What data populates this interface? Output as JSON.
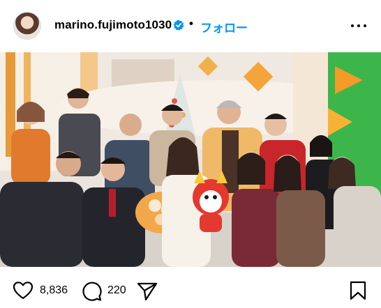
{
  "header": {
    "username": "marino.fujimoto1030",
    "separator": "•",
    "follow_label": "フォロー"
  },
  "photo": {
    "alt": "group photo on a TV studio set with bouquet and mascot"
  },
  "actions": {
    "like_count": "8,836",
    "comment_count": "220"
  },
  "colors": {
    "follow_blue": "#0095f6",
    "verified_blue": "#0095f6",
    "icon_black": "#000000"
  },
  "icons": [
    "avatar",
    "verified-badge-icon",
    "more-options-icon",
    "heart-icon",
    "comment-icon",
    "share-icon",
    "bookmark-icon"
  ]
}
